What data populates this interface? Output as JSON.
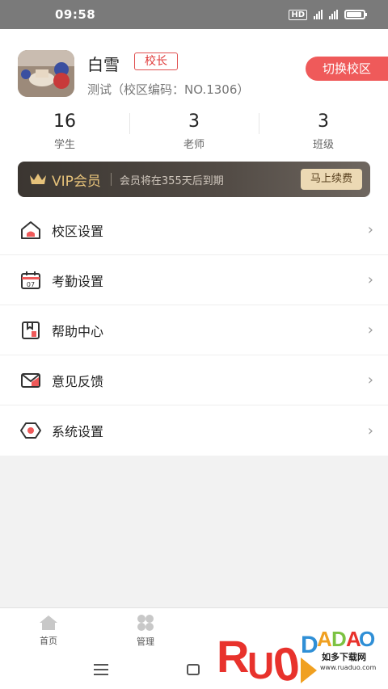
{
  "status_bar": {
    "time": "09:58",
    "network_1": "4G",
    "network_2": "4G",
    "hd_label": "HD"
  },
  "profile": {
    "name": "白雪",
    "role": "校长",
    "school_info": "测试（校区编码：NO.1306）",
    "switch_label": "切换校区"
  },
  "stats": [
    {
      "value": "16",
      "label": "学生"
    },
    {
      "value": "3",
      "label": "老师"
    },
    {
      "value": "3",
      "label": "班级"
    }
  ],
  "vip": {
    "title": "VIP会员",
    "desc": "会员将在355天后到期",
    "renew_label": "马上续费",
    "gold": "#e6c27a"
  },
  "menu": [
    {
      "label": "校区设置",
      "icon": "house-icon"
    },
    {
      "label": "考勤设置",
      "icon": "calendar-icon"
    },
    {
      "label": "帮助中心",
      "icon": "help-book-icon"
    },
    {
      "label": "意见反馈",
      "icon": "envelope-icon"
    },
    {
      "label": "系统设置",
      "icon": "settings-hex-icon"
    }
  ],
  "tabs": [
    {
      "label": "首页",
      "icon": "home-icon"
    },
    {
      "label": "管理",
      "icon": "grid-icon"
    }
  ],
  "watermark": {
    "brand": "RUANDADAO",
    "cn": "如多下载网",
    "url": "www.ruaduo.com"
  },
  "accent": "#ef5a5a"
}
